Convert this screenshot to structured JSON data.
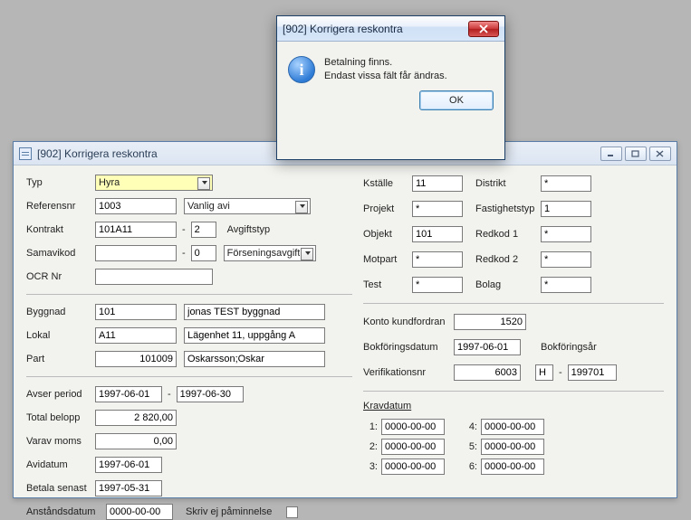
{
  "dialog": {
    "title": "[902]  Korrigera reskontra",
    "msg_line1": "Betalning finns.",
    "msg_line2": "Endast vissa fält får ändras.",
    "ok_label": "OK"
  },
  "window": {
    "title": "[902]  Korrigera reskontra"
  },
  "left": {
    "typ_label": "Typ",
    "typ_value": "Hyra",
    "referensnr_label": "Referensnr",
    "referensnr_value": "1003",
    "avityp_value": "Vanlig avi",
    "kontrakt_label": "Kontrakt",
    "kontrakt_value": "101A11",
    "kontrakt_sub": "2",
    "avgiftstyp_label": "Avgiftstyp",
    "samavikod_label": "Samavikod",
    "samavikod_value": "",
    "samavikod_sub": "0",
    "forsening_value": "Förseningsavgift",
    "ocr_label": "OCR Nr",
    "ocr_value": "",
    "byggnad_label": "Byggnad",
    "byggnad_value": "101",
    "byggnad_name": "jonas TEST byggnad",
    "lokal_label": "Lokal",
    "lokal_value": "A11",
    "lokal_name": "Lägenhet 11, uppgång A",
    "part_label": "Part",
    "part_value": "101009",
    "part_name": "Oskarsson;Oskar",
    "avser_label": "Avser period",
    "avser_from": "1997-06-01",
    "avser_to": "1997-06-30",
    "total_label": "Total belopp",
    "total_value": "2 820,00",
    "moms_label": "Varav moms",
    "moms_value": "0,00",
    "avidatum_label": "Avidatum",
    "avidatum_value": "1997-06-01",
    "betala_label": "Betala senast",
    "betala_value": "1997-05-31",
    "anstand_label": "Anståndsdatum",
    "anstand_value": "0000-00-00",
    "paminnelse_label": "Skriv ej påminnelse"
  },
  "right": {
    "kstalle_label": "Kställe",
    "kstalle_value": "11",
    "distrikt_label": "Distrikt",
    "distrikt_value": "*",
    "projekt_label": "Projekt",
    "projekt_value": "*",
    "fastighetstyp_label": "Fastighetstyp",
    "fastighetstyp_value": "1",
    "objekt_label": "Objekt",
    "objekt_value": "101",
    "redkod1_label": "Redkod 1",
    "redkod1_value": "*",
    "motpart_label": "Motpart",
    "motpart_value": "*",
    "redkod2_label": "Redkod 2",
    "redkod2_value": "*",
    "test_label": "Test",
    "test_value": "*",
    "bolag_label": "Bolag",
    "bolag_value": "*",
    "konto_label": "Konto kundfordran",
    "konto_value": "1520",
    "bokfdatum_label": "Bokföringsdatum",
    "bokfdatum_value": "1997-06-01",
    "bokfar_label": "Bokföringsår",
    "verif_label": "Verifikationsnr",
    "verif_value": "6003",
    "verif_prefix": "H",
    "verif_year": "199701",
    "kravdatum_label": "Kravdatum",
    "krav": {
      "l1": "1:",
      "l2": "2:",
      "l3": "3:",
      "l4": "4:",
      "l5": "5:",
      "l6": "6:",
      "v1": "0000-00-00",
      "v2": "0000-00-00",
      "v3": "0000-00-00",
      "v4": "0000-00-00",
      "v5": "0000-00-00",
      "v6": "0000-00-00"
    }
  }
}
